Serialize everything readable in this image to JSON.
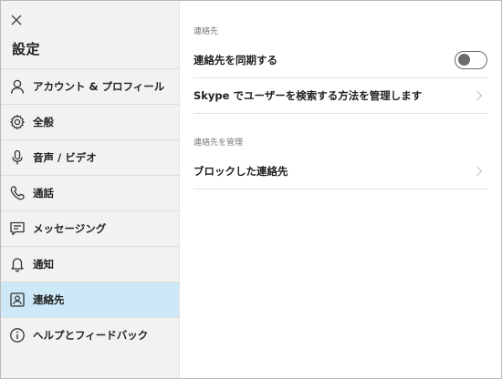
{
  "sidebar": {
    "title": "設定",
    "close_icon": "close-icon",
    "items": [
      {
        "label": "アカウント & プロフィール",
        "icon": "person-icon"
      },
      {
        "label": "全般",
        "icon": "gear-icon"
      },
      {
        "label": "音声 / ビデオ",
        "icon": "microphone-icon"
      },
      {
        "label": "通話",
        "icon": "phone-icon"
      },
      {
        "label": "メッセージング",
        "icon": "message-icon"
      },
      {
        "label": "通知",
        "icon": "bell-icon"
      },
      {
        "label": "連絡先",
        "icon": "contact-card-icon",
        "active": true
      },
      {
        "label": "ヘルプとフィードバック",
        "icon": "info-icon"
      }
    ]
  },
  "main": {
    "section1_header": "連絡先",
    "sync_label": "連絡先を同期する",
    "sync_enabled": false,
    "find_label": "Skype でユーザーを検索する方法を管理します",
    "section2_header": "連絡先を管理",
    "blocked_label": "ブロックした連絡先"
  },
  "colors": {
    "sidebar_bg": "#f2f2f2",
    "active_item_bg": "#cde8f7",
    "toggle_color": "#6b6b6b",
    "divider": "#e2e2e2"
  }
}
